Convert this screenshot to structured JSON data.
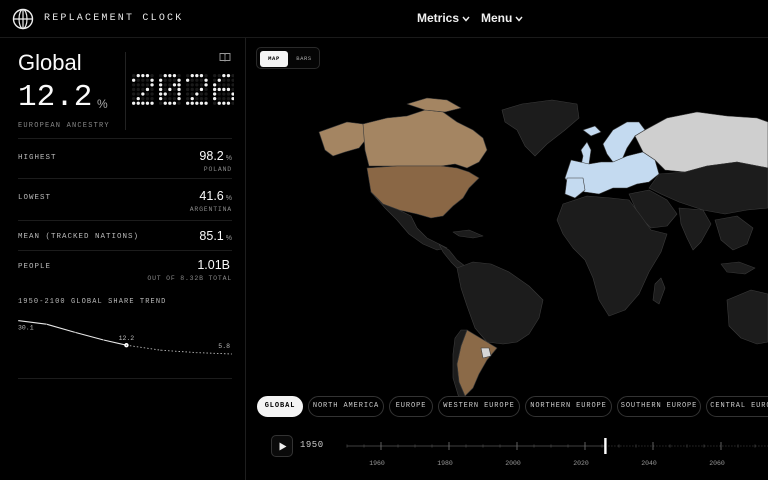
{
  "app": {
    "name": "REPLACEMENT CLOCK"
  },
  "nav": {
    "metrics": "Metrics",
    "menu": "Menu"
  },
  "summary": {
    "region": "Global",
    "share": "12.2",
    "share_unit": "%",
    "label": "EUROPEAN ANCESTRY",
    "year": "2026"
  },
  "stats": [
    {
      "label": "HIGHEST",
      "value": "98.2",
      "unit": "%",
      "sub": "POLAND"
    },
    {
      "label": "LOWEST",
      "value": "41.6",
      "unit": "%",
      "sub": "ARGENTINA"
    },
    {
      "label": "MEAN (TRACKED NATIONS)",
      "value": "85.1",
      "unit": "%",
      "sub": ""
    },
    {
      "label": "PEOPLE",
      "value": "1.01B",
      "unit": "",
      "sub": "OUT OF 8.32B TOTAL"
    }
  ],
  "trend": {
    "title": "1950-2100 GLOBAL SHARE TREND",
    "start_label": "30.1",
    "current_label": "12.2",
    "end_label": "5.8",
    "chart_data": {
      "type": "line",
      "x": [
        1950,
        1970,
        1990,
        2010,
        2026,
        2050,
        2075,
        2100
      ],
      "values": [
        30.1,
        27.5,
        21.5,
        16.0,
        12.2,
        8.6,
        6.8,
        5.8
      ],
      "current_year": 2026
    }
  },
  "view_toggle": {
    "map": "MAP",
    "bars": "BARS",
    "active": "map"
  },
  "regions": [
    "GLOBAL",
    "NORTH AMERICA",
    "EUROPE",
    "WESTERN EUROPE",
    "NORTHERN EUROPE",
    "SOUTHERN EUROPE",
    "CENTRAL EUROPE"
  ],
  "active_region": "GLOBAL",
  "timeline": {
    "current_year": "1950",
    "start": 1950,
    "end": 2100,
    "marker_year": 2026,
    "ticks": [
      "1960",
      "1980",
      "2000",
      "2020",
      "2040",
      "2060"
    ]
  },
  "colors": {
    "background": "#000000",
    "land_default": "#1c1c1c",
    "land_border": "#3a3a3a",
    "europe": "#c4daf0",
    "russia": "#cfcfcf",
    "north_america": "#8a6745",
    "canada": "#a48562",
    "argentina": "#8b6a48",
    "uruguay": "#d6d6d6",
    "chip_active": "#f4f4f4"
  },
  "icons": {
    "logo": "globe-icon",
    "book": "book-icon",
    "play": "play-icon",
    "chevron": "chevron-down-icon"
  }
}
